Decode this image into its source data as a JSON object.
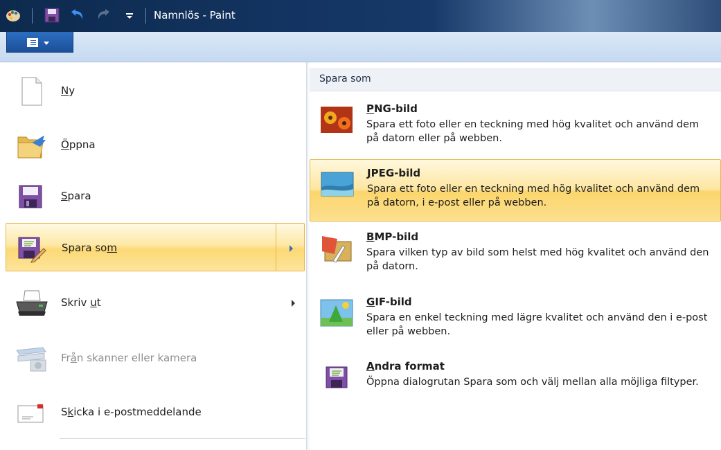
{
  "window": {
    "title": "Namnlös - Paint"
  },
  "left_menu": {
    "items": [
      {
        "label_pre": "",
        "label_ul": "N",
        "label_post": "y"
      },
      {
        "label_pre": "",
        "label_ul": "Ö",
        "label_post": "ppna"
      },
      {
        "label_pre": "",
        "label_ul": "S",
        "label_post": "para"
      },
      {
        "label_pre": "Spara so",
        "label_ul": "m",
        "label_post": ""
      },
      {
        "label_pre": "Skriv ",
        "label_ul": "u",
        "label_post": "t"
      },
      {
        "label_pre": "Fr",
        "label_ul": "å",
        "label_post": "n skanner eller kamera"
      },
      {
        "label_pre": "S",
        "label_ul": "k",
        "label_post": "icka i e-postmeddelande"
      }
    ]
  },
  "save_as": {
    "title": "Spara som",
    "options": [
      {
        "title_ul": "P",
        "title_rest": "NG-bild",
        "desc": "Spara ett foto eller en teckning med hög kvalitet och använd dem på datorn eller på webben."
      },
      {
        "title_ul": "J",
        "title_rest": "PEG-bild",
        "desc": "Spara ett foto eller en teckning med hög kvalitet och använd dem på datorn, i e-post eller på webben."
      },
      {
        "title_ul": "B",
        "title_rest": "MP-bild",
        "desc": "Spara vilken typ av bild som helst med hög kvalitet och använd den på datorn."
      },
      {
        "title_ul": "G",
        "title_rest": "IF-bild",
        "desc": "Spara en enkel teckning med lägre kvalitet och använd den i e-post eller på webben."
      },
      {
        "title_ul": "A",
        "title_rest": "ndra format",
        "desc": "Öppna dialogrutan Spara som och välj mellan alla möjliga filtyper."
      }
    ]
  },
  "icons": {
    "app": "paint-app-icon",
    "save": "floppy-icon",
    "undo": "undo-icon",
    "redo": "redo-icon",
    "customize": "customize-qat-icon",
    "new": "blank-page-icon",
    "open": "folder-open-icon",
    "save_as": "save-as-icon",
    "print": "printer-icon",
    "scanner": "scanner-camera-icon",
    "email": "envelope-icon",
    "png": "png-flowers-icon",
    "jpeg": "jpeg-landscape-icon",
    "bmp": "bmp-paint-icon",
    "gif": "gif-shapes-icon",
    "other": "other-formats-icon"
  }
}
